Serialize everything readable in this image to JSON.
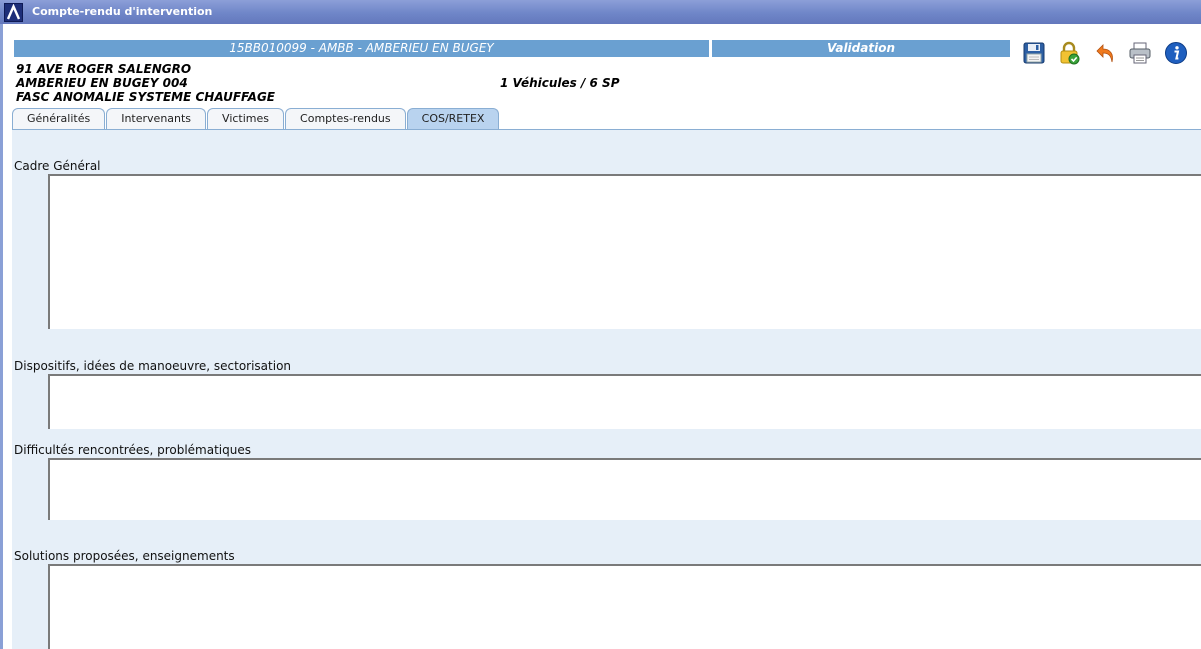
{
  "window": {
    "title": "Compte-rendu d'intervention"
  },
  "header": {
    "intervention": "15BB010099 - AMBB - AMBERIEU EN BUGEY",
    "status": "Validation",
    "address_line1": "91 AVE ROGER SALENGRO",
    "address_line2": "AMBERIEU EN BUGEY 004",
    "address_line3": "FASC ANOMALIE SYSTEME CHAUFFAGE",
    "vehicles": "1 Véhicules  /  6   SP"
  },
  "toolbar": {
    "icons": [
      "save-icon",
      "lock-icon",
      "undo-icon",
      "print-icon",
      "info-icon"
    ]
  },
  "tabs": [
    {
      "label": "Généralités"
    },
    {
      "label": "Intervenants"
    },
    {
      "label": "Victimes"
    },
    {
      "label": "Comptes-rendus"
    },
    {
      "label": "COS/RETEX",
      "active": true
    }
  ],
  "form": {
    "cadre_general_label": "Cadre Général",
    "dispositifs_label": "Dispositifs, idées de manoeuvre, sectorisation",
    "difficultes_label": "Difficultés rencontrées, problématiques",
    "solutions_label": "Solutions proposées, enseignements"
  }
}
